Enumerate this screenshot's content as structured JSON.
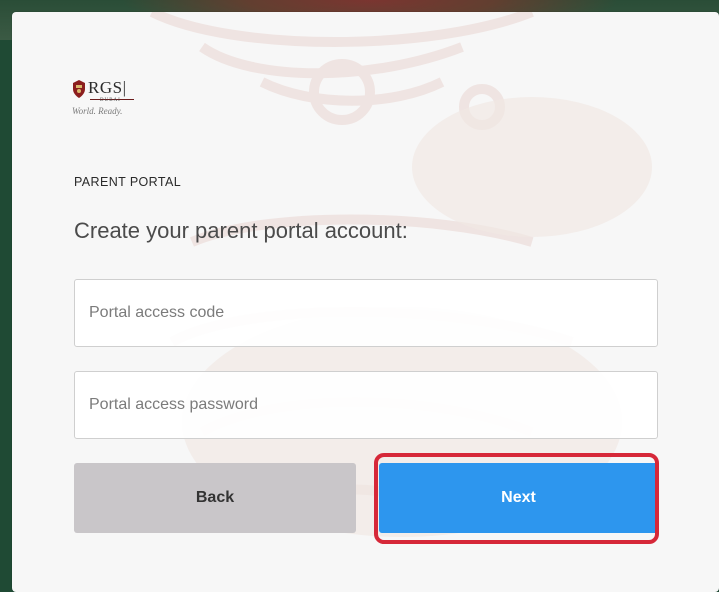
{
  "brand": {
    "logo_text": "RGS|",
    "logo_sub": "DUBAI",
    "tagline": "World. Ready."
  },
  "header": {
    "eyebrow": "PARENT PORTAL",
    "title": "Create your parent portal account:"
  },
  "form": {
    "access_code": {
      "placeholder": "Portal access code",
      "value": ""
    },
    "access_password": {
      "placeholder": "Portal access password",
      "value": ""
    }
  },
  "actions": {
    "back_label": "Back",
    "next_label": "Next"
  },
  "colors": {
    "accent": "#2d96ee",
    "highlight": "#d62839",
    "back_button": "#c9c6c9",
    "page_background": "#1f4a34"
  },
  "icons": {
    "logo_mark": "crest-icon"
  }
}
